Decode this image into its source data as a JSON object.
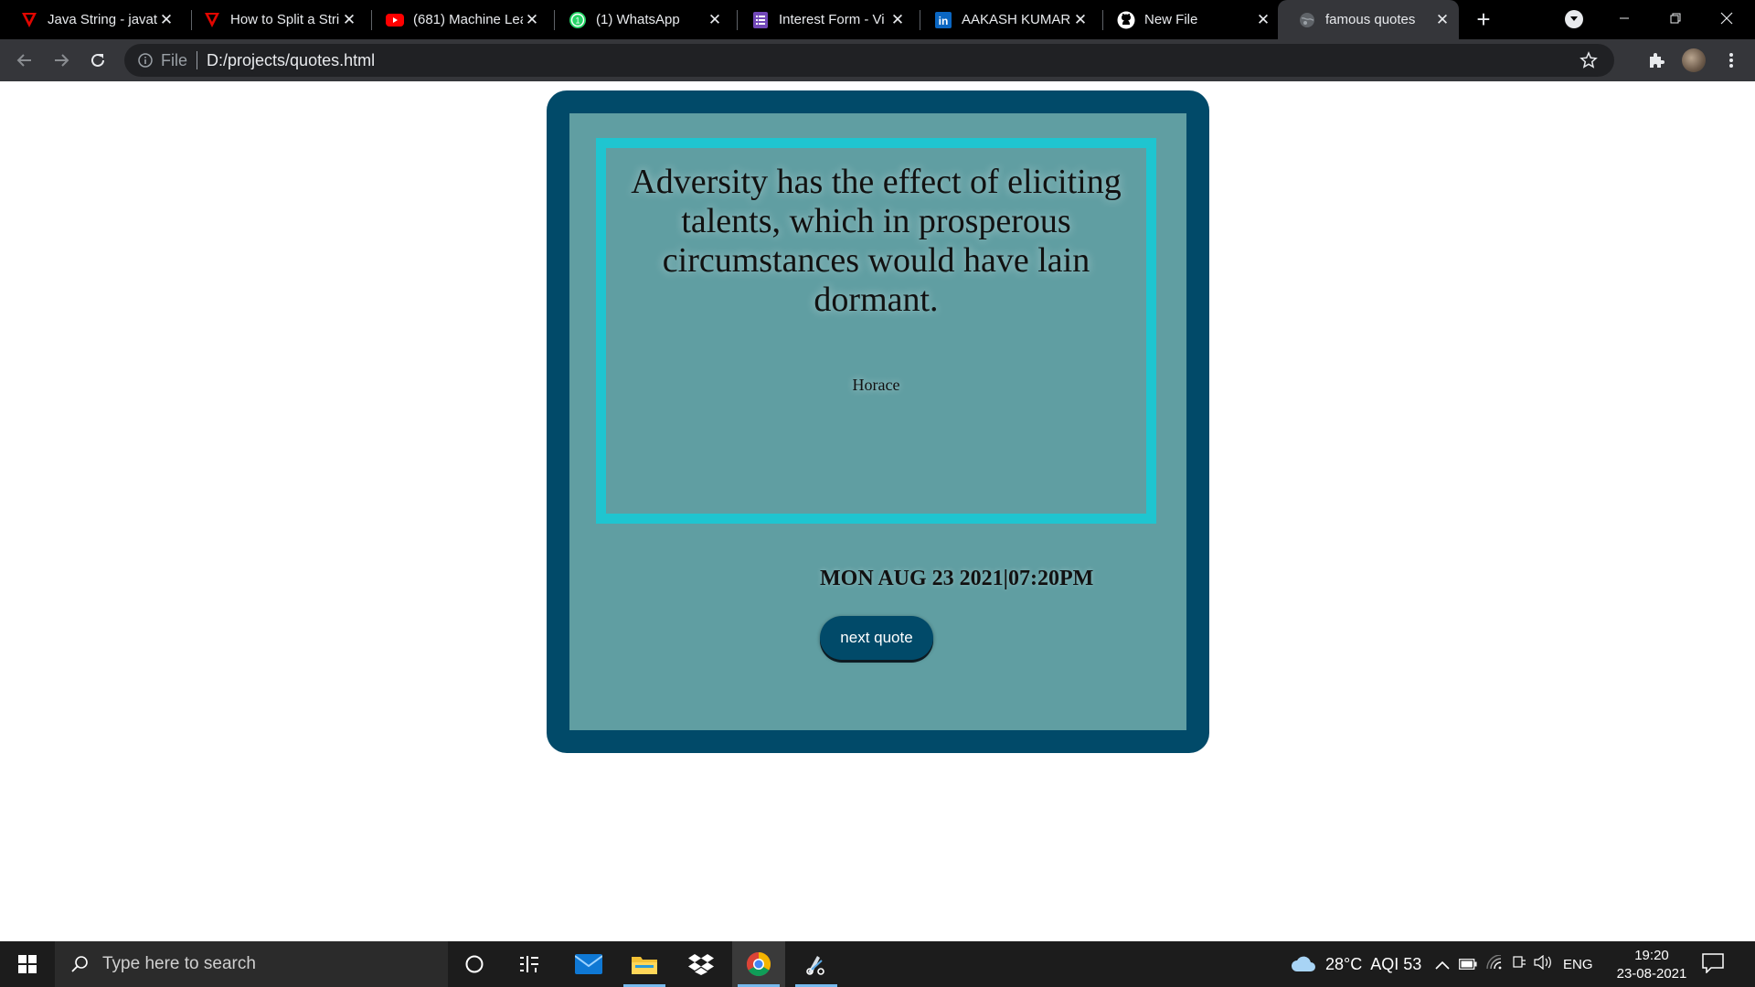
{
  "browser": {
    "tabs": [
      {
        "title": "Java String - javat",
        "icon": "javatpoint-icon"
      },
      {
        "title": "How to Split a Stri",
        "icon": "javatpoint-icon"
      },
      {
        "title": "(681) Machine Lea",
        "icon": "youtube-icon"
      },
      {
        "title": "(1) WhatsApp",
        "icon": "whatsapp-icon"
      },
      {
        "title": "Interest Form - Vi",
        "icon": "forms-icon"
      },
      {
        "title": "AAKASH KUMAR",
        "icon": "linkedin-icon"
      },
      {
        "title": "New File",
        "icon": "github-icon"
      },
      {
        "title": "famous quotes",
        "icon": "globe-icon",
        "active": true
      }
    ],
    "address": {
      "scheme_label": "File",
      "url": "D:/projects/quotes.html"
    }
  },
  "page": {
    "quote": "Adversity has the effect of eliciting talents, which in prosperous circumstances would have lain dormant.",
    "author": "Horace",
    "datetime": "MON AUG 23 2021|07:20PM",
    "next_button": "next quote",
    "colors": {
      "frame": "#014a69",
      "panel": "#609ea2",
      "quote_border": "#1fc5d0",
      "button": "#014a69"
    }
  },
  "taskbar": {
    "search_placeholder": "Type here to search",
    "weather": "28°C",
    "aqi": "AQI 53",
    "language": "ENG",
    "time": "19:20",
    "date": "23-08-2021"
  }
}
